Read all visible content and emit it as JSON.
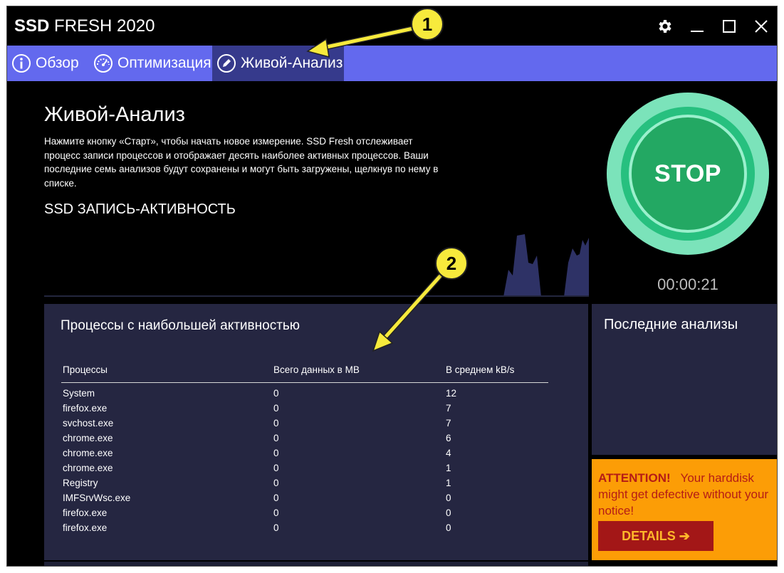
{
  "window": {
    "title_bold": "SSD",
    "title_rest": " FRESH 2020",
    "controls": [
      {
        "icon": "gear-icon"
      },
      {
        "icon": "minimize-icon"
      },
      {
        "icon": "maximize-icon"
      },
      {
        "icon": "close-icon"
      }
    ]
  },
  "tabs": [
    {
      "label": "Обзор",
      "icon": "info-icon",
      "active": false
    },
    {
      "label": "Оптимизация",
      "icon": "speedometer-icon",
      "active": false
    },
    {
      "label": "Живой-Анализ",
      "icon": "pencil-icon",
      "active": true
    }
  ],
  "main": {
    "title": "Живой-Анализ",
    "description": "Нажмите кнопку «Старт», чтобы начать новое измерение. SSD Fresh отслеживает процесс записи процессов и отображает десять наиболее активных процессов. Ваши последние семь анализов будут сохранены и могут быть загружены, щелкнув по нему в списке.",
    "activity_title": "SSD ЗАПИСЬ-АКТИВНОСТЬ"
  },
  "stop_button": {
    "label": "STOP"
  },
  "timer": "00:00:21",
  "processes": {
    "title": "Процессы с наибольшей активностью",
    "columns": [
      "Процессы",
      "Всего данных в MB",
      "В среднем kB/s"
    ],
    "rows": [
      [
        "System",
        "0",
        "12"
      ],
      [
        "firefox.exe",
        "0",
        "7"
      ],
      [
        "svchost.exe",
        "0",
        "7"
      ],
      [
        "chrome.exe",
        "0",
        "6"
      ],
      [
        "chrome.exe",
        "0",
        "4"
      ],
      [
        "chrome.exe",
        "0",
        "1"
      ],
      [
        "Registry",
        "0",
        "1"
      ],
      [
        "IMFSrvWsc.exe",
        "0",
        "0"
      ],
      [
        "firefox.exe",
        "0",
        "0"
      ],
      [
        "firefox.exe",
        "0",
        "0"
      ]
    ]
  },
  "recent": {
    "title": "Последние анализы"
  },
  "attention": {
    "heading": "ATTENTION!",
    "message": "Your harddisk might get defective without your notice!",
    "button": "DETAILS ➔"
  },
  "annotations": [
    {
      "number": "1"
    },
    {
      "number": "2"
    }
  ],
  "colors": {
    "tab_bar": "#6369ee",
    "tab_active": "#363a8c",
    "panel": "#252641",
    "stop_green": "#23a863",
    "attention_bg": "#fc9d06",
    "details_bg": "#a31717",
    "badge": "#f7ea3c"
  }
}
